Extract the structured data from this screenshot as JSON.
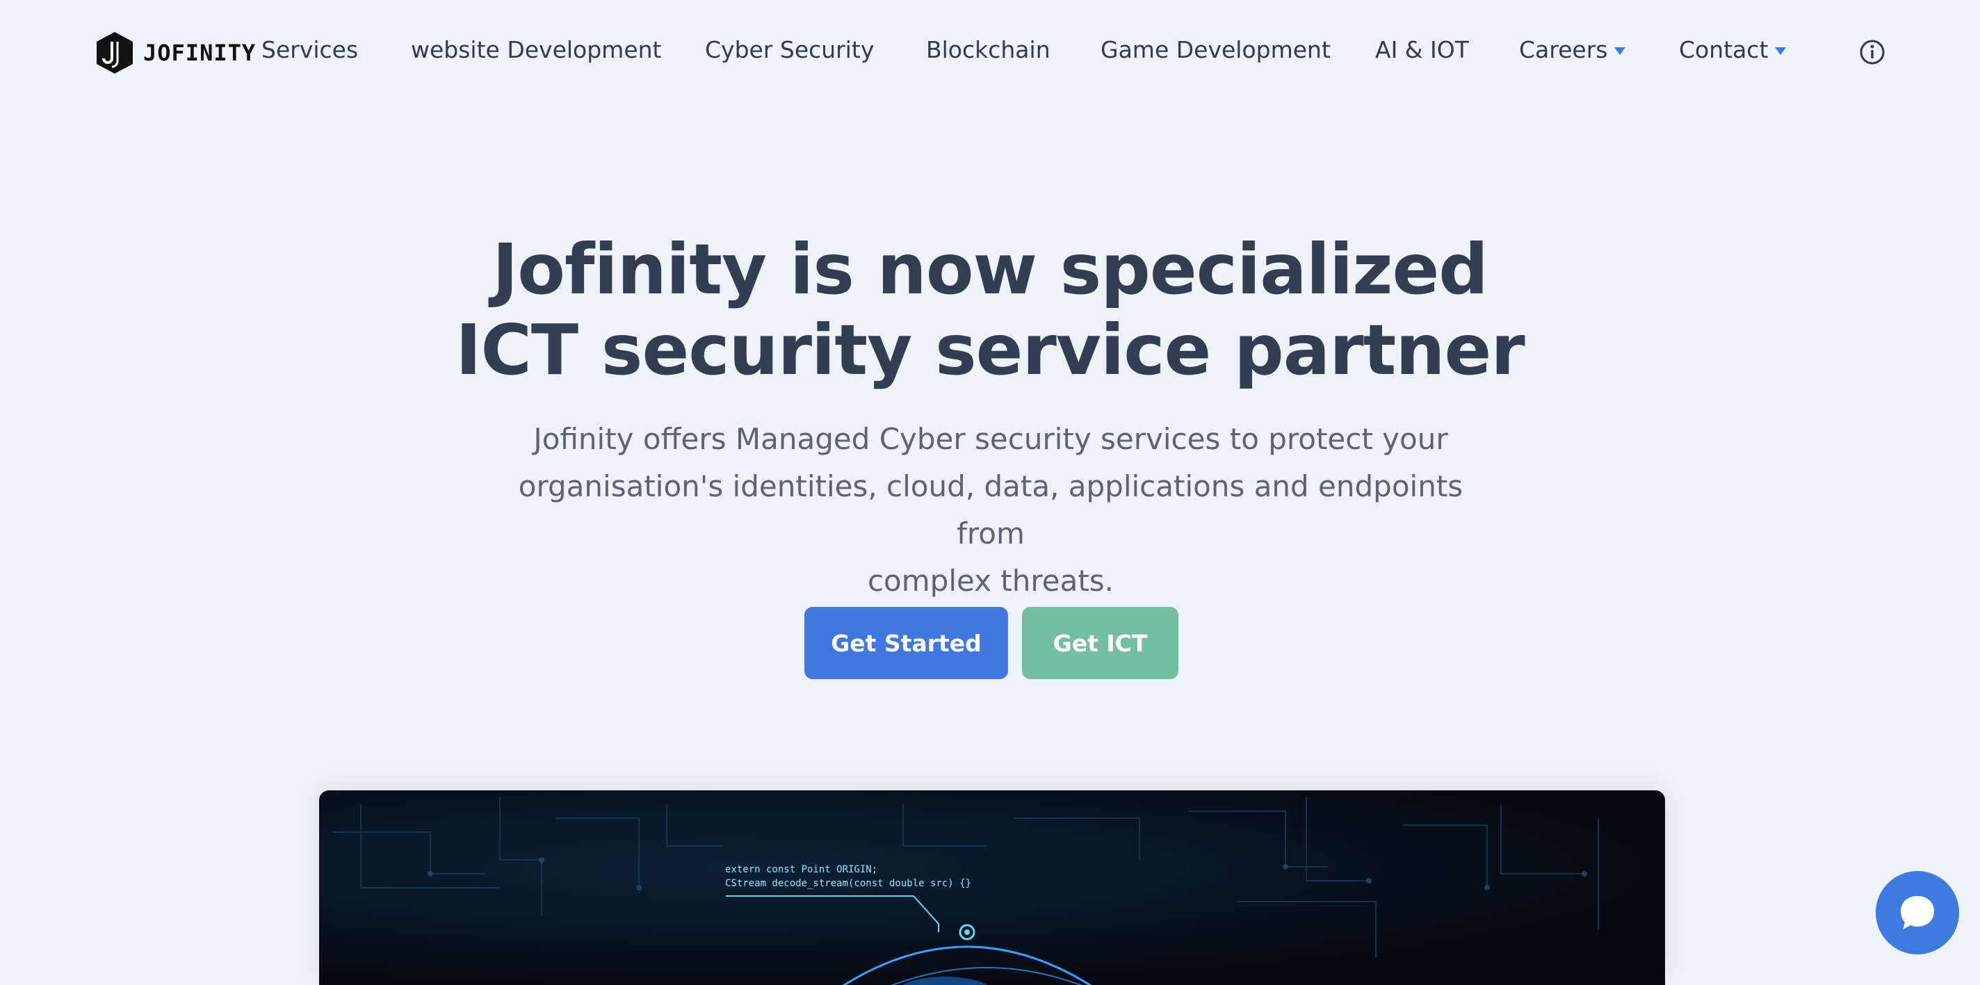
{
  "brand": {
    "name": "JOFINITY"
  },
  "nav": {
    "items": [
      {
        "label": "Services"
      },
      {
        "label": "website Development"
      },
      {
        "label": "Cyber Security"
      },
      {
        "label": "Blockchain"
      },
      {
        "label": "Game Development"
      },
      {
        "label": "AI & IOT"
      },
      {
        "label": "Careers",
        "dropdown": true
      },
      {
        "label": "Contact",
        "dropdown": true
      }
    ]
  },
  "hero": {
    "title_line1": "Jofinity is now specialized",
    "title_line2": "ICT security service partner",
    "subtitle_line1": "Jofinity offers Managed Cyber security services to protect your",
    "subtitle_line2": "organisation's identities, cloud, data, applications and endpoints from",
    "subtitle_line3": "complex threats.",
    "primary_cta": "Get Started",
    "secondary_cta": "Get ICT"
  },
  "media": {
    "code_line1": "extern const Point ORIGIN;",
    "code_line2": "CStream decode_stream(const double src) {}"
  },
  "colors": {
    "background": "#eef3fa",
    "primary": "#4177e0",
    "secondary": "#74bf9e",
    "text": "#333e52"
  },
  "icons": {
    "info": "info-circle-icon",
    "chat": "chat-bubble-icon",
    "caret": "caret-down-icon"
  }
}
